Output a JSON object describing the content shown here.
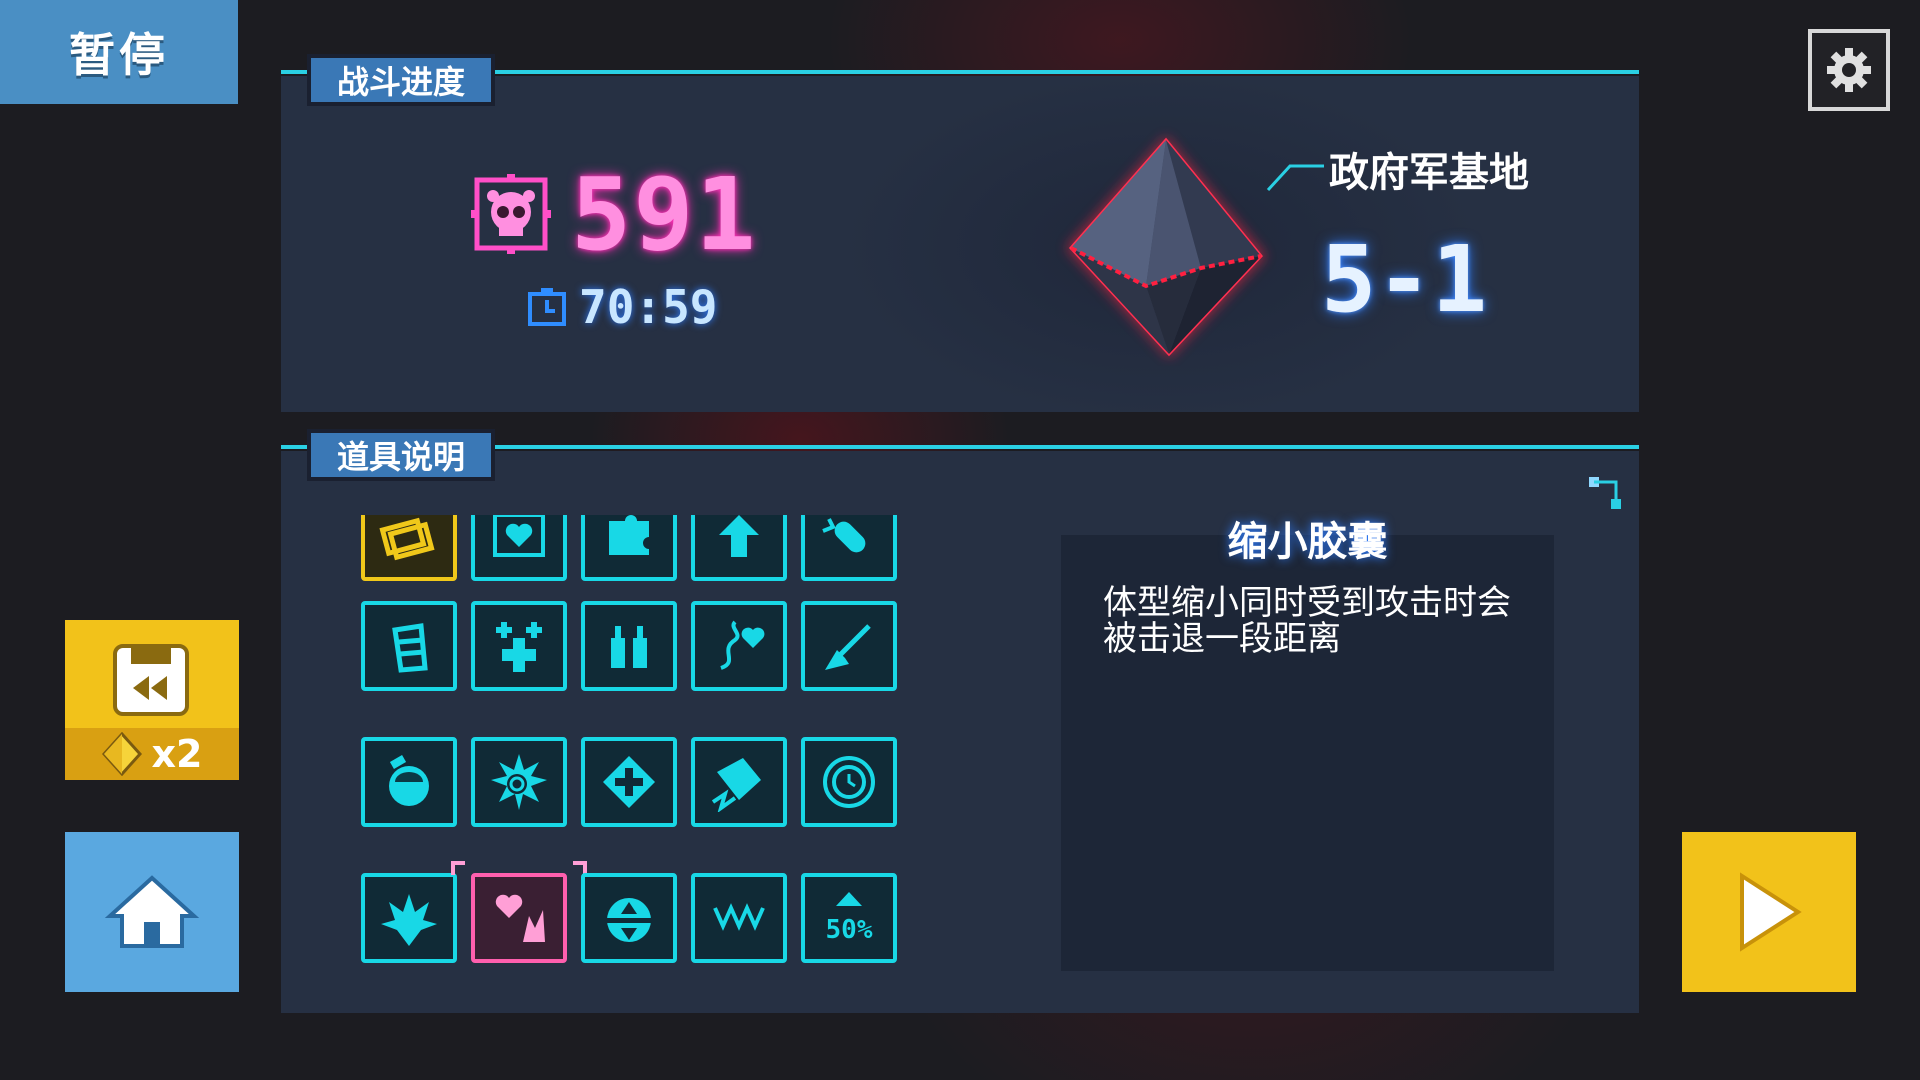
{
  "header": {
    "pause_title": "暂停"
  },
  "progress_panel": {
    "tab_label": "战斗进度",
    "kill_count": "591",
    "timer": "70:59",
    "location_name": "政府军基地",
    "stage": "5-1"
  },
  "items_panel": {
    "tab_label": "道具说明",
    "selected_item": {
      "name": "缩小胶囊",
      "description": "体型缩小同时受到攻击时会被击退一段距离"
    }
  },
  "buttons": {
    "restore_cost": "x2"
  },
  "colors": {
    "accent_cyan": "#18d8e6",
    "kill_pink": "#ff8fe0",
    "button_yellow": "#f2c21a",
    "button_blue": "#5aa8e0",
    "panel_bg": "#263043"
  },
  "icons": {
    "settings": "gear-icon",
    "home": "home-icon",
    "play": "play-icon",
    "restore": "floppy-rewind-icon",
    "currency": "diamond-icon",
    "kills": "skull-icon",
    "timer": "timer-icon"
  }
}
